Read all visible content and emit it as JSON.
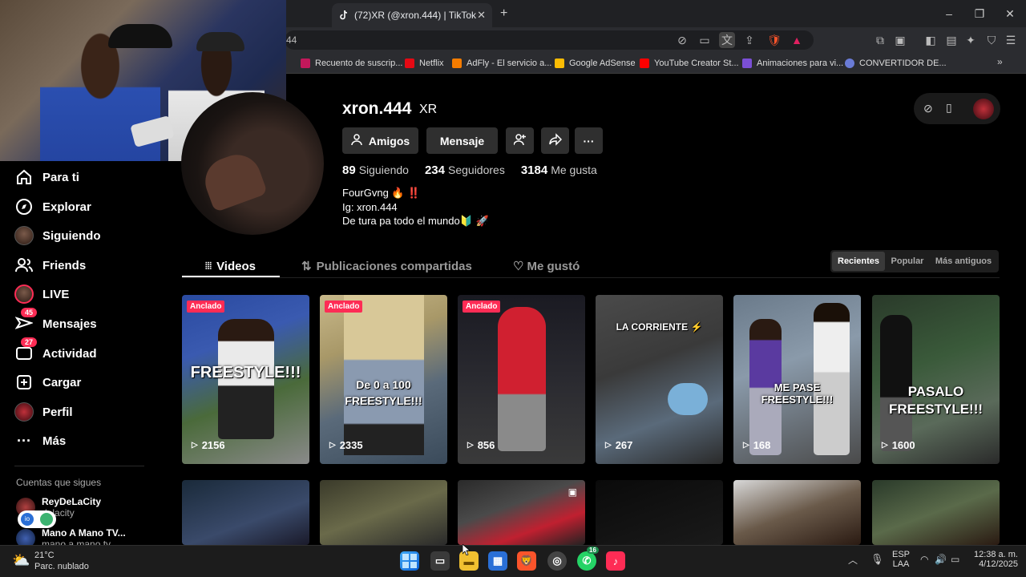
{
  "browser": {
    "tab_title": "(72)XR (@xron.444) | TikTok",
    "url_fragment": "44",
    "bookmarks": [
      {
        "label": "Recuento de suscrip...",
        "color": "#c2185b"
      },
      {
        "label": "Netflix",
        "color": "#e50914"
      },
      {
        "label": "AdFly - El servicio a...",
        "color": "#f57c00"
      },
      {
        "label": "Google AdSense",
        "color": "#fbbc04"
      },
      {
        "label": "YouTube Creator St...",
        "color": "#ff0000"
      },
      {
        "label": "Animaciones para vi...",
        "color": "#7b4fd6"
      },
      {
        "label": "CONVERTIDOR DE...",
        "color": "#6a7bd6"
      }
    ]
  },
  "sidebar": {
    "items": [
      {
        "label": "Para ti",
        "icon": "home-icon"
      },
      {
        "label": "Explorar",
        "icon": "compass-icon"
      },
      {
        "label": "Siguiendo",
        "icon": "following-avatar"
      },
      {
        "label": "Friends",
        "icon": "friends-icon"
      },
      {
        "label": "LIVE",
        "icon": "live-icon"
      },
      {
        "label": "Mensajes",
        "icon": "messages-icon",
        "badge": "45"
      },
      {
        "label": "Actividad",
        "icon": "activity-icon",
        "badge": "27"
      },
      {
        "label": "Cargar",
        "icon": "upload-icon"
      },
      {
        "label": "Perfil",
        "icon": "profile-avatar"
      },
      {
        "label": "Más",
        "icon": "more-icon"
      }
    ],
    "following_title": "Cuentas que sigues",
    "following": [
      {
        "name": "ReyDeLaCity",
        "handle": "delacity"
      },
      {
        "name": "Mano A Mano TV...",
        "handle": "mano a mano tv"
      }
    ]
  },
  "profile": {
    "username": "xron.444",
    "nickname": "XR",
    "buttons": {
      "friends": "Amigos",
      "message": "Mensaje"
    },
    "stats": {
      "following_count": "89",
      "following_label": "Siguiendo",
      "followers_count": "234",
      "followers_label": "Seguidores",
      "likes_count": "3184",
      "likes_label": "Me gusta"
    },
    "bio": [
      "FourGvng 🔥 ‼️",
      "Ig: xron.444",
      "De tura pa todo el mundo🔰 🚀"
    ]
  },
  "tabs": {
    "videos": "Videos",
    "reposts": "Publicaciones compartidas",
    "liked": "Me gustó"
  },
  "sort": {
    "recent": "Recientes",
    "popular": "Popular",
    "oldest": "Más antiguos"
  },
  "pinned_label": "Anclado",
  "videos": [
    {
      "views": "2156",
      "caption": "FREESTYLE!!!",
      "pinned": true
    },
    {
      "views": "2335",
      "caption": "De 0 a 100 FREESTYLE!!!",
      "pinned": true
    },
    {
      "views": "856",
      "caption": "",
      "pinned": true
    },
    {
      "views": "267",
      "caption": "LA CORRIENTE ⚡",
      "pinned": false
    },
    {
      "views": "168",
      "caption": "ME PASE FREESTYLE!!!",
      "pinned": false
    },
    {
      "views": "1600",
      "caption": "PASALO FREESTYLE!!!",
      "pinned": false
    }
  ],
  "taskbar": {
    "temperature": "21°C",
    "weather": "Parc. nublado",
    "lang": "ESP",
    "lang2": "LAA",
    "time": "12:38 a. m.",
    "date": "4/12/2025",
    "whatsapp_badge": "16"
  }
}
